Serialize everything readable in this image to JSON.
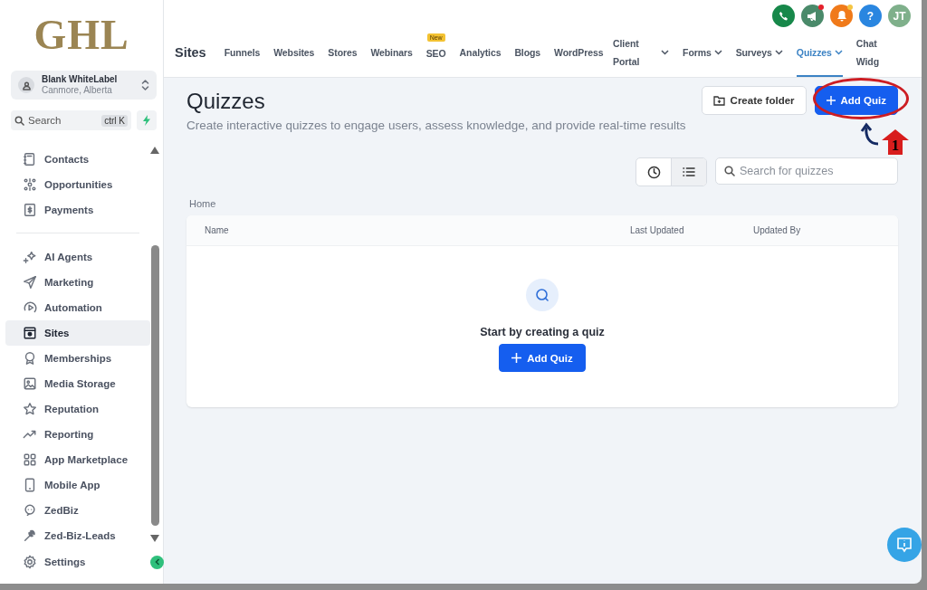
{
  "brand": {
    "logo": "GHL"
  },
  "account": {
    "name": "Blank WhiteLabel",
    "location": "Canmore, Alberta"
  },
  "sidebar_search": {
    "placeholder": "Search",
    "shortcut": "ctrl K"
  },
  "sidebar": {
    "groups": [
      {
        "items": [
          {
            "label": "Contacts",
            "selected": false
          },
          {
            "label": "Opportunities",
            "selected": false
          },
          {
            "label": "Payments",
            "selected": false
          }
        ]
      },
      {
        "items": [
          {
            "label": "AI Agents",
            "selected": false
          },
          {
            "label": "Marketing",
            "selected": false
          },
          {
            "label": "Automation",
            "selected": false
          },
          {
            "label": "Sites",
            "selected": true
          },
          {
            "label": "Memberships",
            "selected": false
          },
          {
            "label": "Media Storage",
            "selected": false
          },
          {
            "label": "Reputation",
            "selected": false
          },
          {
            "label": "Reporting",
            "selected": false
          },
          {
            "label": "App Marketplace",
            "selected": false
          },
          {
            "label": "Mobile App",
            "selected": false
          },
          {
            "label": "ZedBiz",
            "selected": false
          },
          {
            "label": "Zed-Biz-Leads",
            "selected": false
          }
        ]
      }
    ],
    "footer": {
      "label": "Settings",
      "selected": false
    }
  },
  "top_icons": {
    "help": "?",
    "avatar": "JT"
  },
  "nav": {
    "title": "Sites",
    "tabs": [
      {
        "label": "Funnels",
        "selected": false,
        "dropdown": false
      },
      {
        "label": "Websites",
        "selected": false,
        "dropdown": false
      },
      {
        "label": "Stores",
        "selected": false,
        "dropdown": false
      },
      {
        "label": "Webinars",
        "selected": false,
        "dropdown": false
      },
      {
        "label": "SEO",
        "selected": false,
        "dropdown": false,
        "badge": "New"
      },
      {
        "label": "Analytics",
        "selected": false,
        "dropdown": false
      },
      {
        "label": "Blogs",
        "selected": false,
        "dropdown": false
      },
      {
        "label": "WordPress",
        "selected": false,
        "dropdown": false
      },
      {
        "label": "Client Portal",
        "selected": false,
        "dropdown": true
      },
      {
        "label": "Forms",
        "selected": false,
        "dropdown": true
      },
      {
        "label": "Surveys",
        "selected": false,
        "dropdown": true
      },
      {
        "label": "Quizzes",
        "selected": true,
        "dropdown": true
      },
      {
        "label": "Chat Widg",
        "selected": false,
        "dropdown": false
      }
    ]
  },
  "page": {
    "title": "Quizzes",
    "subtitle": "Create interactive quizzes to engage users, assess knowledge, and provide real-time results",
    "buttons": [
      {
        "label": "Create folder",
        "kind": "secondary"
      },
      {
        "label": "Add Quiz",
        "kind": "primary"
      }
    ],
    "annotation": {
      "step": "1"
    },
    "view_toggle": [
      {
        "kind": "clock",
        "selected": false
      },
      {
        "kind": "list",
        "selected": true
      }
    ],
    "search": {
      "placeholder": "Search for quizzes"
    },
    "breadcrumb": "Home",
    "table": {
      "columns": [
        "Name",
        "Last Updated",
        "Updated By"
      ],
      "empty_state": {
        "message": "Start by creating a quiz",
        "button": "Add Quiz"
      }
    }
  }
}
